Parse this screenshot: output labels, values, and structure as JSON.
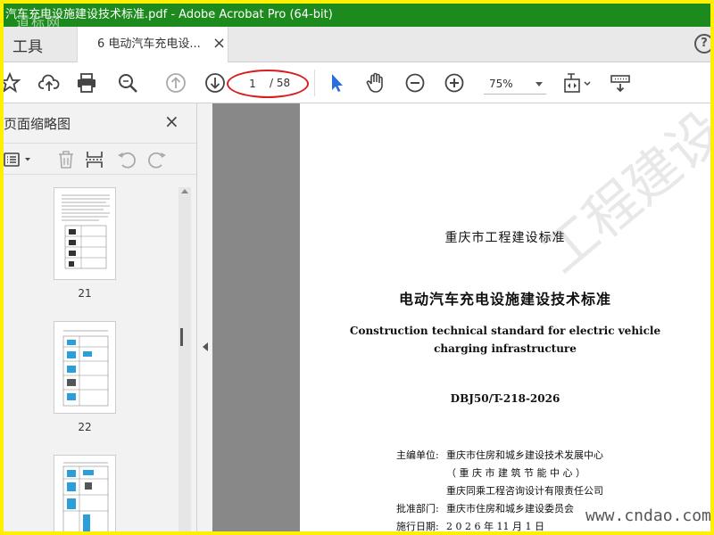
{
  "window": {
    "title": "汽车充电设施建设技术标准.pdf - Adobe Acrobat Pro (64-bit)",
    "watermark": "道标网"
  },
  "tabs": {
    "tools_label": "工具",
    "doc_tab_label": "6 电动汽车充电设...",
    "close_glyph": "×",
    "help_glyph": "?"
  },
  "toolbar": {
    "page_current": "1",
    "page_total": "/ 58",
    "zoom": "75%",
    "annotation_color": "#d91c1c"
  },
  "sidebar": {
    "title": "页面缩略图",
    "close_glyph": "×",
    "thumbnails": [
      {
        "label": "21"
      },
      {
        "label": "22"
      },
      {
        "label": ""
      }
    ]
  },
  "document": {
    "org": "重庆市工程建设标准",
    "title_cn": "电动汽车充电设施建设技术标准",
    "title_en_line1": "Construction technical standard for electric vehicle",
    "title_en_line2": "charging infrastructure",
    "code": "DBJ50/T-218-2026",
    "info": [
      {
        "label": "主编单位:",
        "value": "重庆市住房和城乡建设技术发展中心"
      },
      {
        "label": "",
        "value": "（ 重 庆 市 建 筑 节 能 中 心 ）"
      },
      {
        "label": "",
        "value": "重庆同乘工程咨询设计有限责任公司"
      },
      {
        "label": "批准部门:",
        "value": "重庆市住房和城乡建设委员会"
      },
      {
        "label": "施行日期:",
        "value": "2 0 2 6 年 11 月 1 日"
      }
    ],
    "bg_watermark": "工程建设",
    "bottom_watermark": "www.cndao.com"
  },
  "colors": {
    "titlebar": "#1d8a1d",
    "frame": "#ffef00",
    "select_tool": "#2a6fdb"
  }
}
